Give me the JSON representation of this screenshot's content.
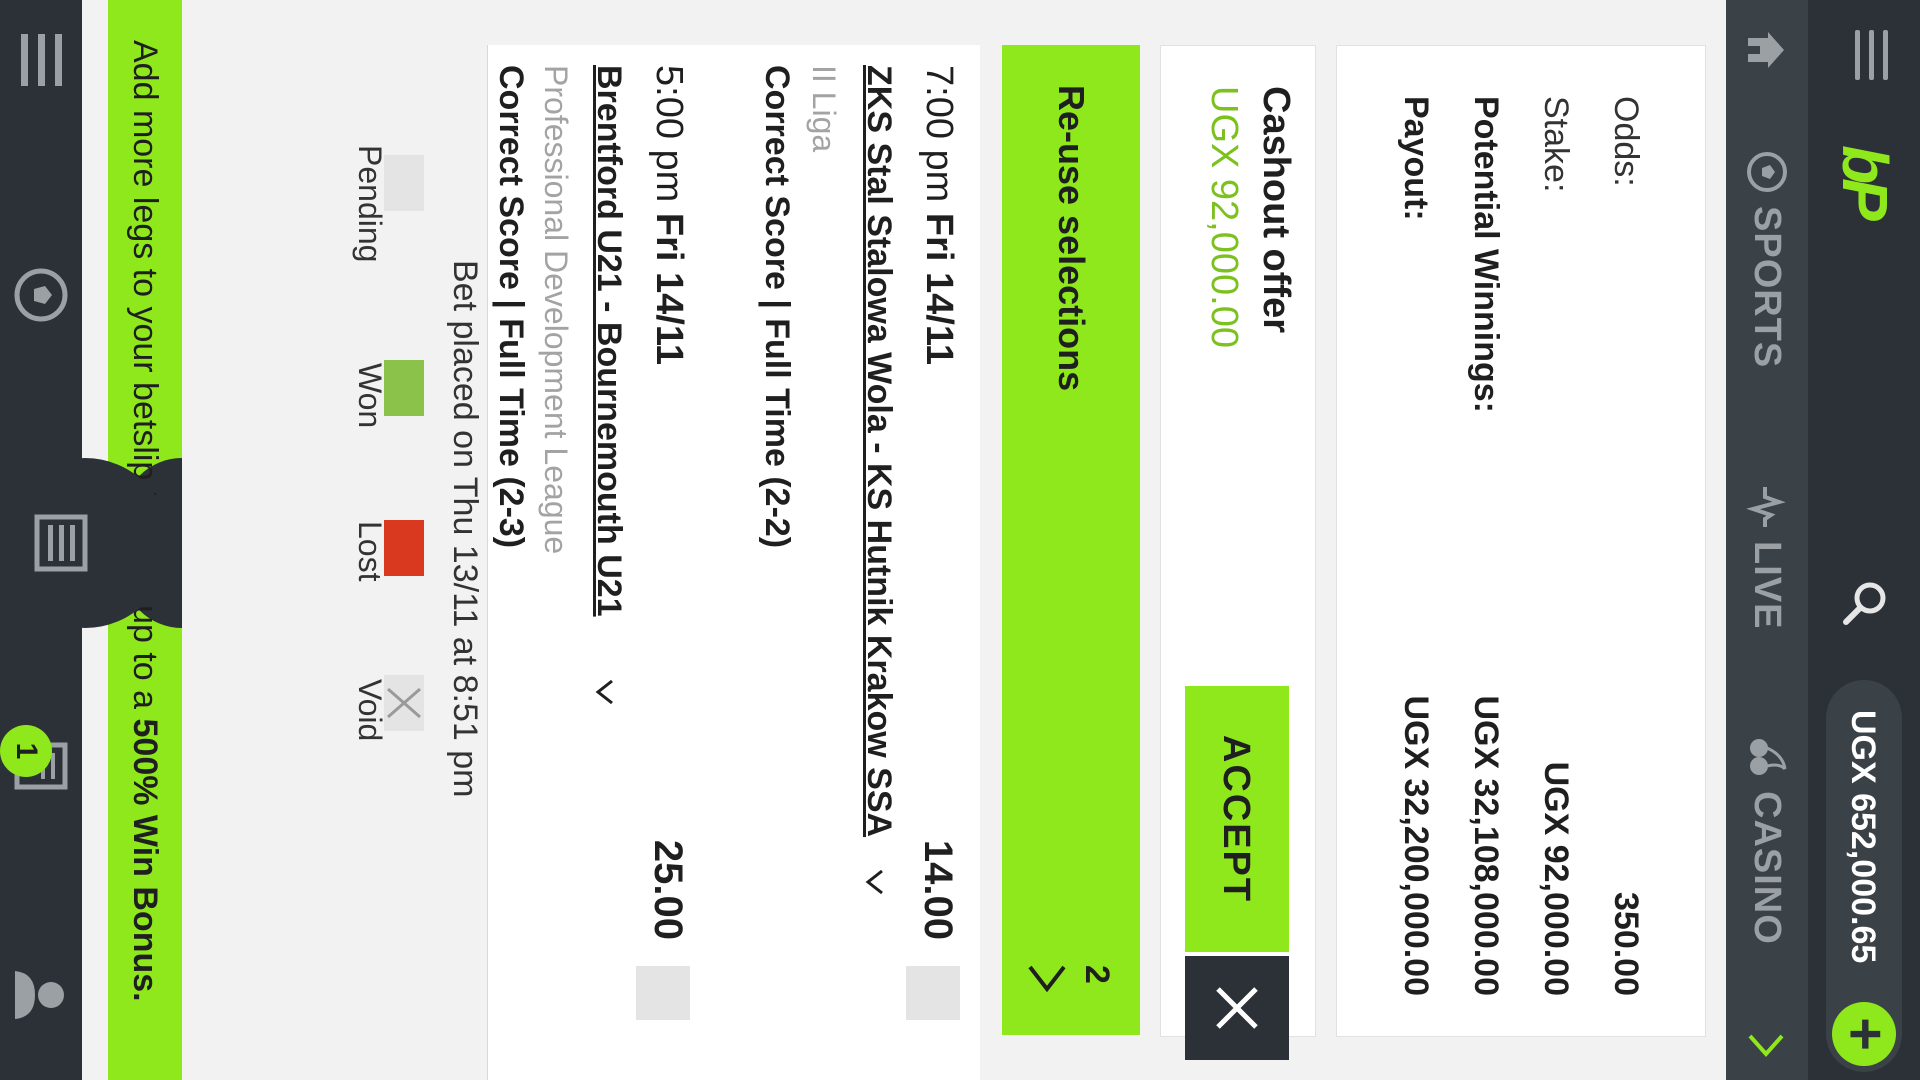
{
  "header": {
    "logo": "bP",
    "balance": "UGX 652,000.65"
  },
  "nav": {
    "sports": "SPORTS",
    "live": "LIVE",
    "casino": "CASINO"
  },
  "summary": {
    "odds_label": "Odds:",
    "odds_value": "350.00",
    "stake_label": "Stake:",
    "stake_value": "UGX 92,000.00",
    "potential_label": "Potential Winnings:",
    "potential_value": "UGX 32,108,000.00",
    "payout_label": "Payout:",
    "payout_value": "UGX 32,200,000.00"
  },
  "cashout": {
    "label": "Cashout offer",
    "amount": "UGX 92,000.00",
    "accept": "ACCEPT"
  },
  "reuse": {
    "label": "Re-use selections",
    "count": "2"
  },
  "selections": [
    {
      "time": "7:00 pm",
      "date": "Fri 14/11",
      "odds": "14.00",
      "match": "ZKS Stal Stalowa Wola - KS Hutnik Krakow SSA",
      "league": "II Liga",
      "market": "Correct Score | Full Time (2-2)"
    },
    {
      "time": "5:00 pm",
      "date": "Fri 14/11",
      "odds": "25.00",
      "match": "Brentford U21 - Bournemouth U21",
      "league": "Professional Development League",
      "market": "Correct Score | Full Time (2-3)"
    }
  ],
  "placed": "Bet placed on Thu 13/11 at 8:51 pm",
  "legend": {
    "pending": "Pending",
    "won": "Won",
    "lost": "Lost",
    "void": "Void"
  },
  "banner": {
    "text_before": "Add more legs to your betslip to earn up to a ",
    "text_bold": "500% Win Bonus.",
    "badge": "1"
  },
  "colors": {
    "accent": "#8fe81c",
    "dark": "#2b3136",
    "won": "#8bc34a",
    "lost": "#d93a1f",
    "pending": "#e4e4e4"
  }
}
